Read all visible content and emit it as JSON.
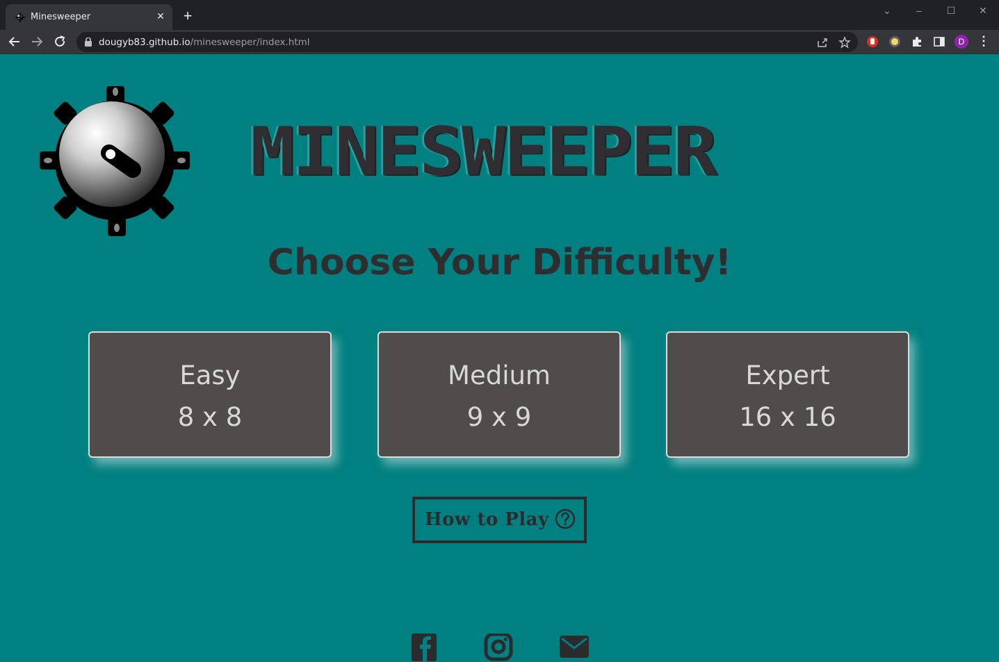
{
  "browser": {
    "tab_title": "Minesweeper",
    "url_host": "dougyb83.github.io",
    "url_path": "/minesweeper/index.html",
    "profile_initial": "D"
  },
  "page": {
    "title": "MINESWEEPER",
    "subtitle": "Choose Your Difficulty!",
    "difficulties": [
      {
        "name": "Easy",
        "size": "8 x 8"
      },
      {
        "name": "Medium",
        "size": "9 x 9"
      },
      {
        "name": "Expert",
        "size": "16 x 16"
      }
    ],
    "how_to_play": "How to Play",
    "social": [
      "facebook-icon",
      "instagram-icon",
      "email-icon"
    ],
    "colors": {
      "background": "#008080",
      "card": "#4f4c4b",
      "text_dark": "#2e2e30"
    }
  }
}
